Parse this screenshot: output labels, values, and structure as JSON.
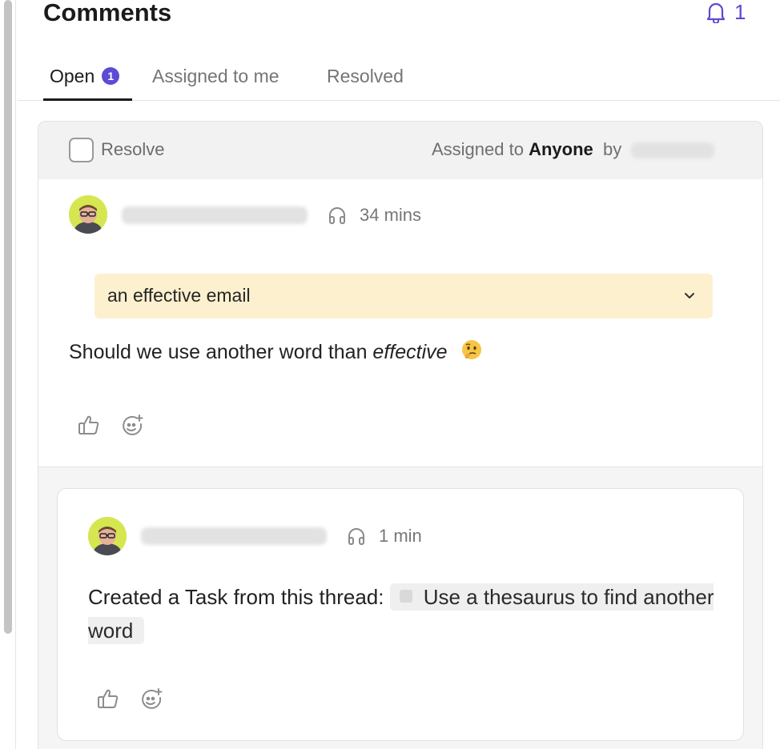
{
  "header": {
    "title": "Comments",
    "notification_count": "1"
  },
  "tabs": [
    {
      "label": "Open",
      "badge": "1",
      "active": true
    },
    {
      "label": "Assigned to me",
      "active": false
    },
    {
      "label": "Resolved",
      "active": false
    }
  ],
  "thread": {
    "resolve_label": "Resolve",
    "assigned_prefix": "Assigned to",
    "assigned_to": "Anyone",
    "assigned_by_prefix": "by",
    "comment": {
      "time": "34 mins",
      "quoted_text": "an effective email",
      "text_before": "Should we use another word than ",
      "text_italic": "effective",
      "emoji_icon": "thinking-face-icon"
    },
    "reply": {
      "time": "1 min",
      "text": "Created a Task from this thread: ",
      "task_name": "Use a thesaurus to find another word"
    }
  },
  "colors": {
    "accent": "#5b4bd6",
    "quote_bg": "#fdf0cf"
  }
}
